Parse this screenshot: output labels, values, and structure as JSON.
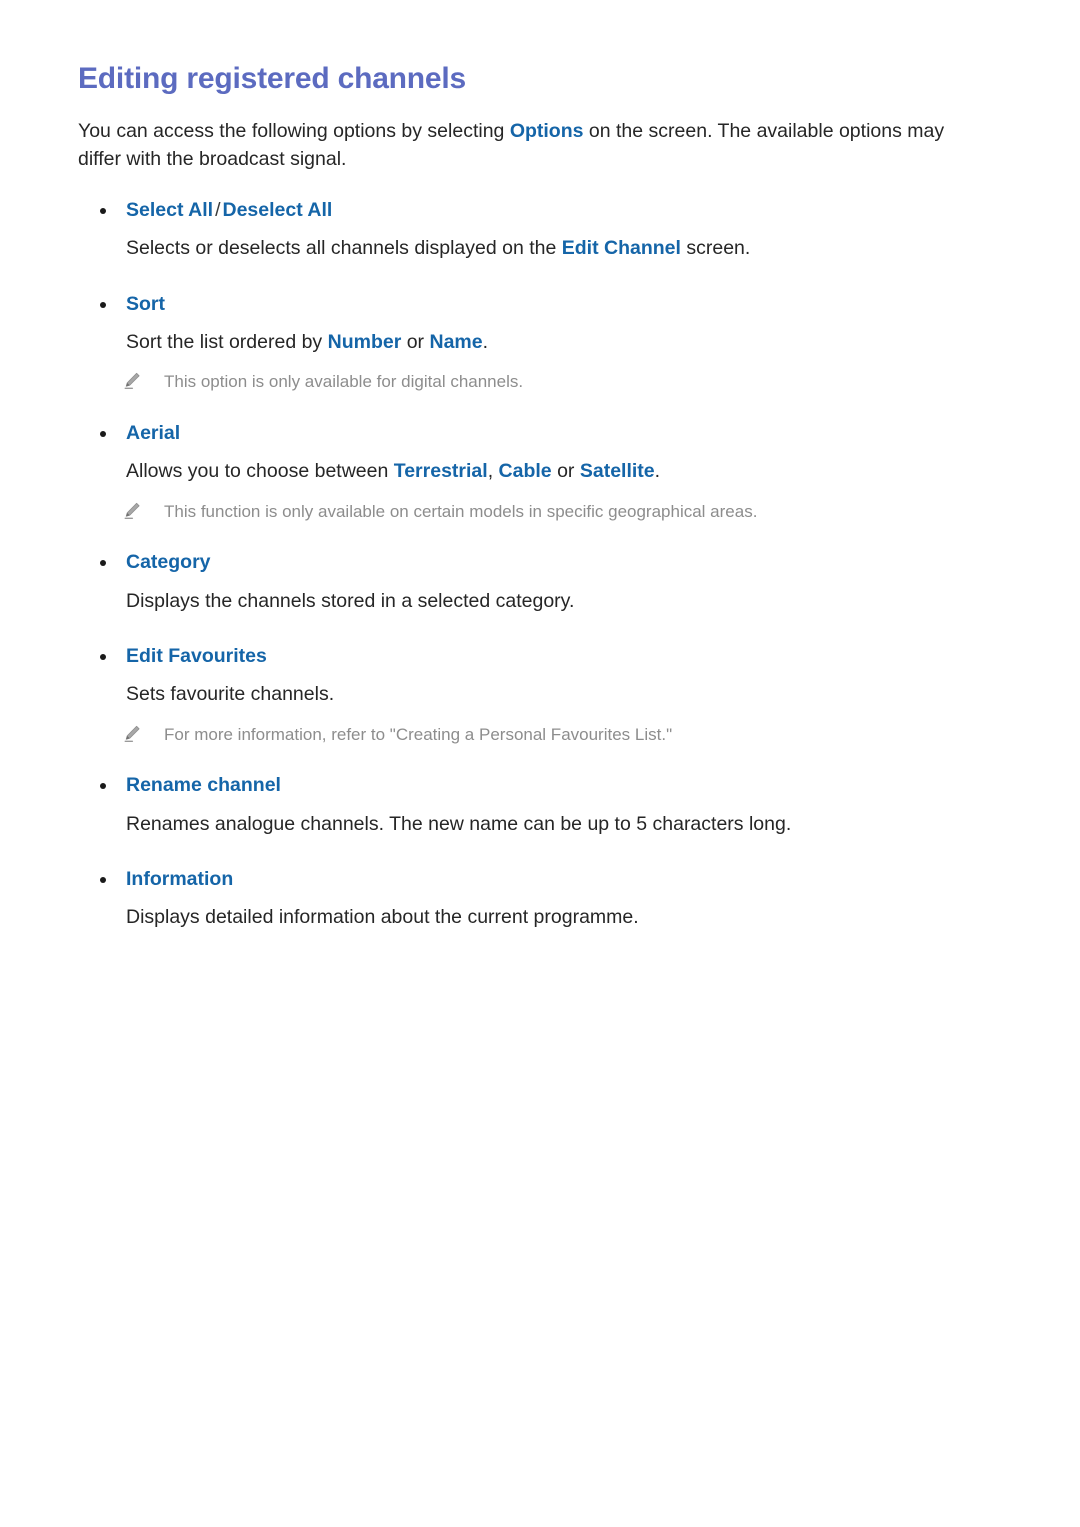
{
  "document": {
    "title": "Editing registered channels",
    "intro": "You can access the following options by selecting Options on the screen. The available options may differ with the broadcast signal.",
    "intro_parts": {
      "before": "You can access the following options by selecting ",
      "link": "Options",
      "after": " on the screen. The available options may differ with the broadcast signal."
    }
  },
  "colors": {
    "heading": "#5c6bc0",
    "link": "#1565a8",
    "body": "#262626",
    "note": "#8d8d8d",
    "background": "#ffffff"
  },
  "options": [
    {
      "label_primary": "Select All",
      "separator": "/",
      "label_secondary": "Deselect All",
      "description_before": "Selects or deselects all channels displayed on the ",
      "description_highlight": "Edit Channel",
      "description_after": " screen.",
      "note": null
    },
    {
      "label_primary": "Sort",
      "description_before": "Sort the list ordered by ",
      "description_highlight": "Number",
      "description_middle": " or ",
      "description_highlight2": "Name",
      "description_after": ".",
      "note": "This option is only available for digital channels."
    },
    {
      "label_primary": "Aerial",
      "description_before": "Allows you to choose between ",
      "description_highlight": "Terrestrial",
      "description_middle": ", ",
      "description_highlight2": "Cable",
      "description_middle2": " or ",
      "description_highlight3": "Satellite",
      "description_after": ".",
      "note": "This function is only available on certain models in specific geographical areas."
    },
    {
      "label_primary": "Category",
      "description": "Displays the channels stored in a selected category.",
      "note": null
    },
    {
      "label_primary": "Edit Favourites",
      "description": "Sets favourite channels.",
      "note": "For more information, refer to \"Creating a Personal Favourites List.\""
    },
    {
      "label_primary": "Rename channel",
      "description": "Renames analogue channels. The new name can be up to 5 characters long.",
      "note": null
    },
    {
      "label_primary": "Information",
      "description": "Displays detailed information about the current programme.",
      "note": null
    }
  ],
  "icons": {
    "note_icon_name": "pencil-icon"
  }
}
